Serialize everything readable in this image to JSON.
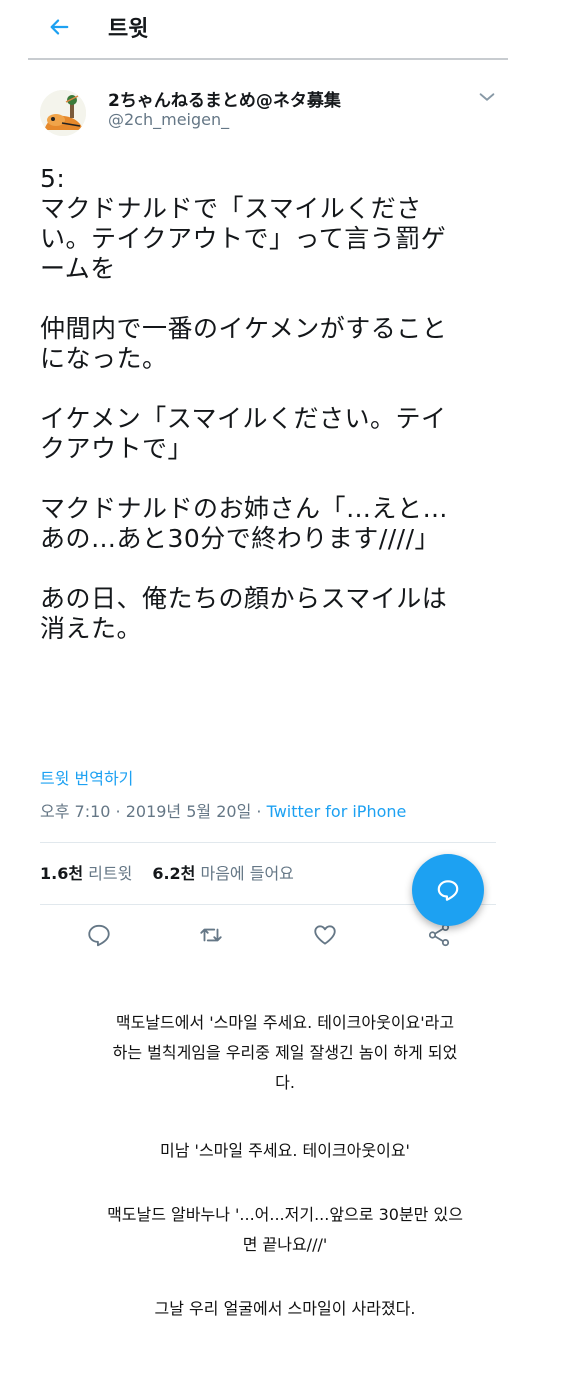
{
  "header": {
    "title": "트윗",
    "back_icon": "arrow-left-icon"
  },
  "author": {
    "display_name": "2ちゃんねるまとめ@ネタ募集",
    "handle": "@2ch_meigen_",
    "more_icon": "chevron-down-icon"
  },
  "tweet": {
    "text": "5:\nマクドナルドで「スマイルくださ\nい。テイクアウトで」って言う罰ゲ\nームを\n\n仲間内で一番のイケメンがすること\nになった。\n\nイケメン「スマイルください。テイ\nクアウトで」\n\nマクドナルドのお姉さん「…えと…\nあの…あと30分で終わります////」\n\nあの日、俺たちの顔からスマイルは\n消えた。",
    "translate": "트윗 번역하기",
    "time": "오후 7:10 · 2019년 5월 20일 · ",
    "source": "Twitter for iPhone"
  },
  "stats": {
    "retweets_count": "1.6천",
    "retweets_label": " 리트윗",
    "likes_count": "6.2천",
    "likes_label": " 마음에 들어요"
  },
  "actions": [
    "reply-icon",
    "retweet-icon",
    "like-icon",
    "share-icon"
  ],
  "fab_icon": "compose-reply-icon",
  "caption": {
    "p1": "맥도날드에서 '스마일 주세요. 테이크아웃이요'라고\n하는 벌칙게임을 우리중 제일 잘생긴 놈이 하게 되었\n다.",
    "p2": "미남 '스마일 주세요. 테이크아웃이요'",
    "p3": "맥도날드 알바누나 '...어...저기...앞으로 30분만 있으\n면 끝나요///'",
    "p4": "그날 우리 얼굴에서 스마일이 사라졌다."
  },
  "colors": {
    "accent": "#1da1f2",
    "secondary_text": "#657786",
    "divider": "#e1e8ed"
  }
}
